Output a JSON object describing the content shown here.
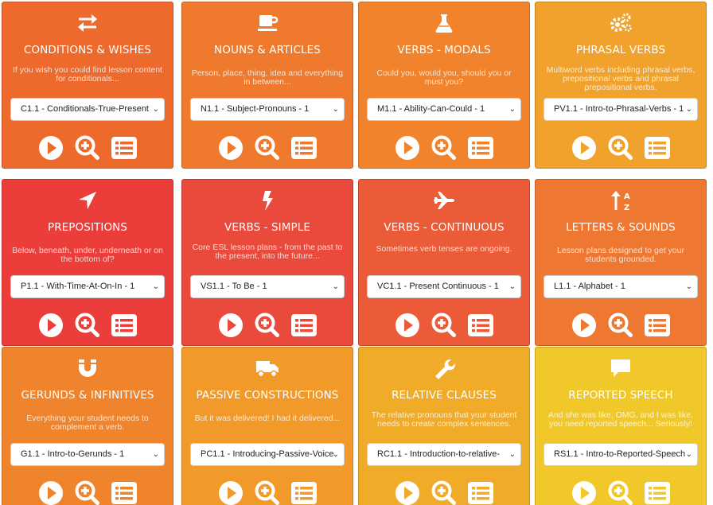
{
  "cards": [
    {
      "title": "CONDITIONS & WISHES",
      "desc": "If you wish you could find lesson content for conditionals...",
      "select_value": "C1.1 - Conditionals-True-Present",
      "icon": "exchange-icon",
      "color": "#ee6a2c"
    },
    {
      "title": "NOUNS & ARTICLES",
      "desc": "Person, place, thing, idea and everything in between...",
      "select_value": "N1.1 - Subject-Pronouns - 1",
      "icon": "coffee-cup-icon",
      "color": "#ef7a2d"
    },
    {
      "title": "VERBS - MODALS",
      "desc": "Could you, would you, should you or must you?",
      "select_value": "M1.1 - Ability-Can-Could - 1",
      "icon": "flask-icon",
      "color": "#f0832c"
    },
    {
      "title": "PHRASAL VERBS",
      "desc": "Multiword verbs including phrasal verbs, prepositional verbs and phrasal prepositional verbs.",
      "select_value": "PV1.1 - Intro-to-Phrasal-Verbs - 1",
      "icon": "gears-icon",
      "color": "#f0a22d"
    },
    {
      "title": "PREPOSITIONS",
      "desc": "Below, beneath, under, underneath or on the bottom of?",
      "select_value": "P1.1 - With-Time-At-On-In - 1",
      "icon": "location-arrow-icon",
      "color": "#eb3d3a"
    },
    {
      "title": "VERBS - SIMPLE",
      "desc": "Core ESL lesson plans - from the past to the present, into the future...",
      "select_value": "VS1.1 - To Be - 1",
      "icon": "bolt-icon",
      "color": "#ea4a3c"
    },
    {
      "title": "VERBS - CONTINUOUS",
      "desc": "Sometimes verb tenses are ongoing.",
      "select_value": "VC1.1 - Present Continuous - 1",
      "icon": "plane-icon",
      "color": "#eb5b37"
    },
    {
      "title": "LETTERS & SOUNDS",
      "desc": "Lesson plans designed to get your students grounded.",
      "select_value": "L1.1 - Alphabet - 1",
      "icon": "sort-alpha-icon",
      "color": "#ee7831"
    },
    {
      "title": "GERUNDS & INFINITIVES",
      "desc": "Everything your student needs to complement a verb.",
      "select_value": "G1.1 - Intro-to-Gerunds - 1",
      "icon": "magnet-icon",
      "color": "#f0842c"
    },
    {
      "title": "PASSIVE CONSTRUCTIONS",
      "desc": "But it was delivered! I had it delivered...",
      "select_value": "PC1.1 - Introducing-Passive-Voice",
      "icon": "truck-icon",
      "color": "#f19a2a"
    },
    {
      "title": "RELATIVE CLAUSES",
      "desc": "The relative pronouns that your student needs to create complex sentences.",
      "select_value": "RC1.1 - Introduction-to-relative-",
      "icon": "wrench-icon",
      "color": "#f0ab29"
    },
    {
      "title": "REPORTED SPEECH",
      "desc": "And she was like, OMG, and I was like, you need reported speech... Seriously!",
      "select_value": "RS1.1 - Intro-to-Reported-Speech",
      "icon": "speech-bubble-icon",
      "color": "#f1c82a"
    }
  ],
  "actions": [
    "play-icon",
    "zoom-in-icon",
    "list-icon"
  ]
}
